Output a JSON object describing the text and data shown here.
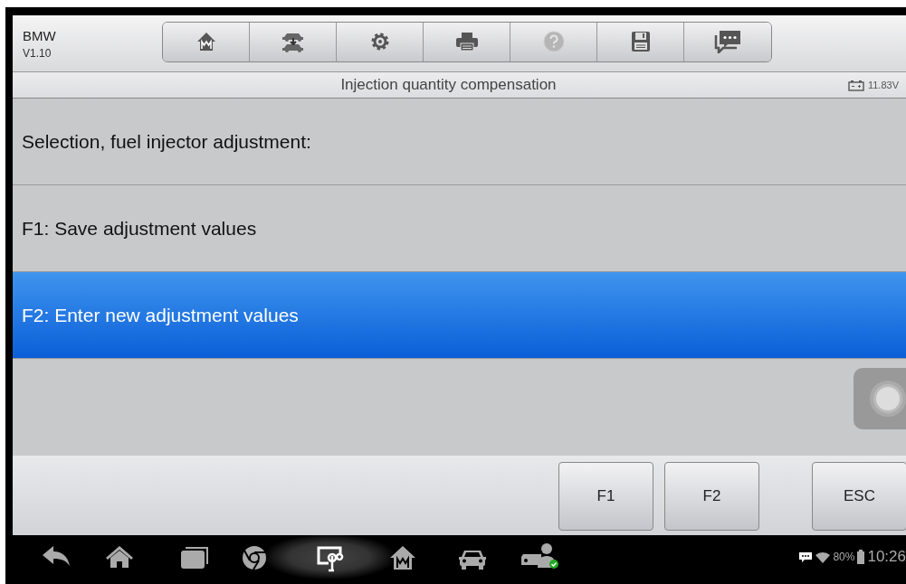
{
  "app": {
    "brand": "BMW",
    "version": "V1.10"
  },
  "title_bar": {
    "title": "Injection quantity compensation",
    "battery_voltage": "11.83V"
  },
  "list": {
    "header": "Selection, fuel injector adjustment:",
    "items": [
      {
        "label": "F1: Save adjustment values",
        "selected": false
      },
      {
        "label": "F2: Enter new adjustment values",
        "selected": true
      }
    ]
  },
  "function_keys": [
    {
      "label": "F1",
      "kind": "function"
    },
    {
      "label": "F2",
      "kind": "function"
    },
    {
      "label": "ESC",
      "kind": "escape"
    }
  ],
  "status_bar": {
    "battery": "80%",
    "time": "10:26"
  }
}
